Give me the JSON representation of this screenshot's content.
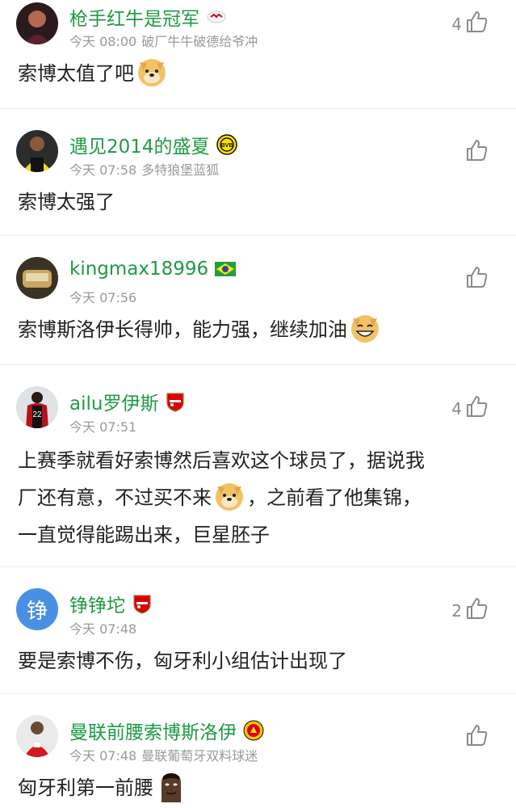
{
  "comments": [
    {
      "username": "枪手红牛是冠军",
      "time": "今天 08:00",
      "tag": "破厂牛牛破德给爷冲",
      "likes": "4",
      "text_parts": [
        "索博太值了吧"
      ],
      "badge_icon": "leipzig-badge-icon",
      "avatar_icon": "user-avatar-photo"
    },
    {
      "username": "遇见2014的盛夏",
      "time": "今天 07:58",
      "tag": "多特狼堡蓝狐",
      "likes": "",
      "text_parts": [
        "索博太强了"
      ],
      "badge_icon": "dortmund-badge-icon",
      "avatar_icon": "user-avatar-photo"
    },
    {
      "username": "kingmax18996",
      "time": "今天 07:56",
      "tag": "",
      "likes": "",
      "text_parts": [
        "索博斯洛伊长得帅，能力强，继续加油"
      ],
      "badge_icon": "brazil-flag-icon",
      "avatar_icon": "user-avatar-photo"
    },
    {
      "username": "ailu罗伊斯",
      "time": "今天 07:51",
      "tag": "",
      "likes": "4",
      "text_parts": [
        "上赛季就看好索博然后喜欢这个球员了，据说我",
        "厂还有意，不过买不来",
        "，之前看了他集锦，",
        "一直觉得能踢出来，巨星胚子"
      ],
      "badge_icon": "arsenal-badge-icon",
      "avatar_icon": "user-avatar-photo"
    },
    {
      "username": "铮铮坨",
      "avatar_letter": "铮",
      "time": "今天 07:48",
      "tag": "",
      "likes": "2",
      "text_parts": [
        "要是索博不伤，匈牙利小组估计出现了"
      ],
      "badge_icon": "arsenal-badge-icon",
      "avatar_icon": "letter-avatar"
    },
    {
      "username": "曼联前腰索博斯洛伊",
      "time": "今天 07:48",
      "tag": "曼联葡萄牙双料球迷",
      "likes": "",
      "text_parts": [
        "匈牙利第一前腰"
      ],
      "badge_icon": "man-utd-badge-icon",
      "avatar_icon": "user-avatar-photo"
    }
  ],
  "colors": {
    "username": "#1f9a44",
    "meta": "#9a9a9a",
    "divider": "#ececec",
    "letter_avatar_bg": "#4a90e2"
  }
}
